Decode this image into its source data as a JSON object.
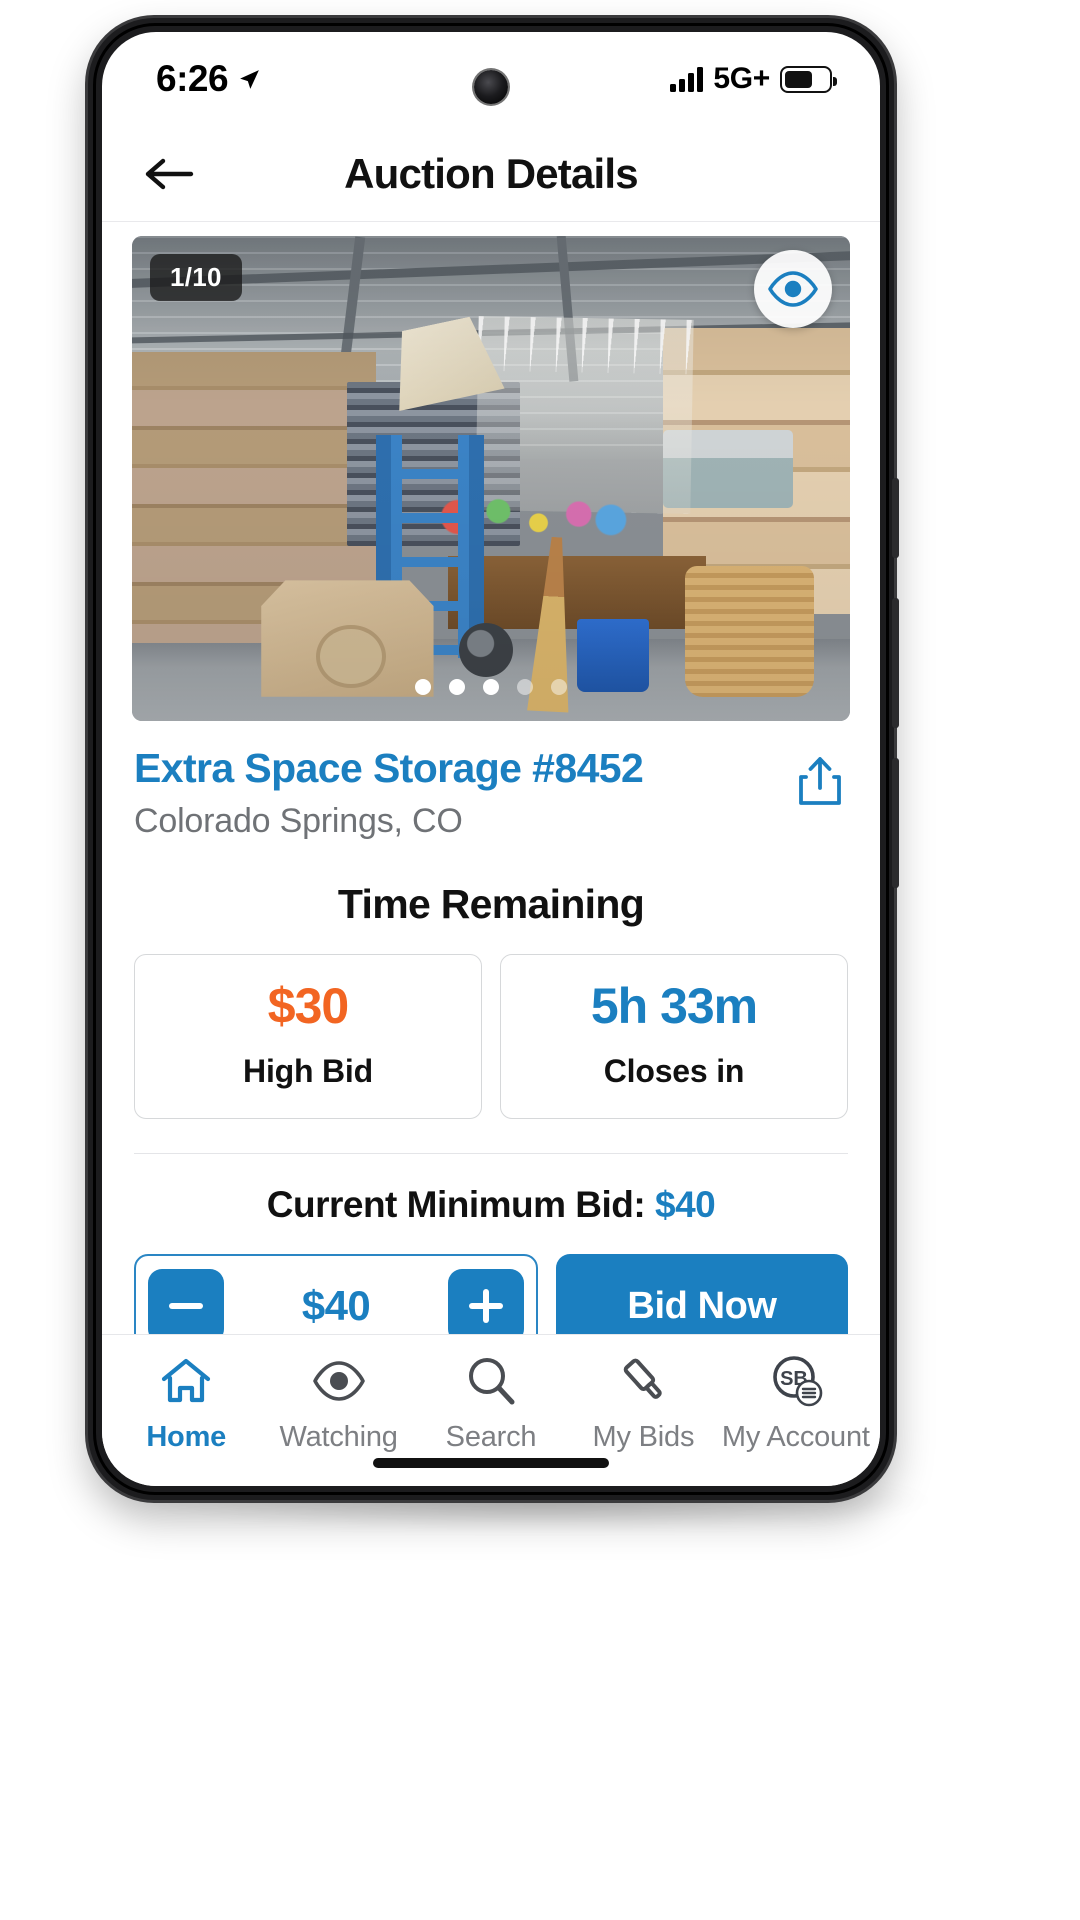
{
  "status_bar": {
    "time": "6:26",
    "location_icon": "location-arrow-icon",
    "signal_icon": "signal-bars-icon",
    "network": "5G+",
    "battery_icon": "battery-icon"
  },
  "header": {
    "back_icon": "back-arrow-icon",
    "title": "Auction Details"
  },
  "gallery": {
    "counter": "1/10",
    "watch_icon": "eye-icon",
    "dot_count": 5,
    "active_dot": 0
  },
  "listing": {
    "facility": "Extra Space Storage #8452",
    "location": "Colorado Springs, CO",
    "share_icon": "share-icon"
  },
  "time_remaining": {
    "heading": "Time Remaining",
    "cards": [
      {
        "value": "$30",
        "label": "High Bid",
        "color": "#f26522"
      },
      {
        "value": "5h 33m",
        "label": "Closes in",
        "color": "#1b7fc0"
      }
    ]
  },
  "bidding": {
    "min_bid_label": "Current Minimum Bid:",
    "min_bid_amount": "$40",
    "decrement_icon": "minus-icon",
    "bid_value": "$40",
    "increment_icon": "plus-icon",
    "bid_now_label": "Bid Now"
  },
  "bottom_nav": {
    "items": [
      {
        "label": "Home",
        "icon": "home-icon",
        "active": true
      },
      {
        "label": "Watching",
        "icon": "eye-icon",
        "active": false
      },
      {
        "label": "Search",
        "icon": "search-icon",
        "active": false
      },
      {
        "label": "My Bids",
        "icon": "gavel-icon",
        "active": false
      },
      {
        "label": "My Account",
        "icon": "account-avatar-icon",
        "initials": "SB",
        "active": false
      }
    ]
  },
  "colors": {
    "brand_blue": "#1b7fc0",
    "accent_orange": "#f26522",
    "muted_text": "#7d7f83"
  }
}
